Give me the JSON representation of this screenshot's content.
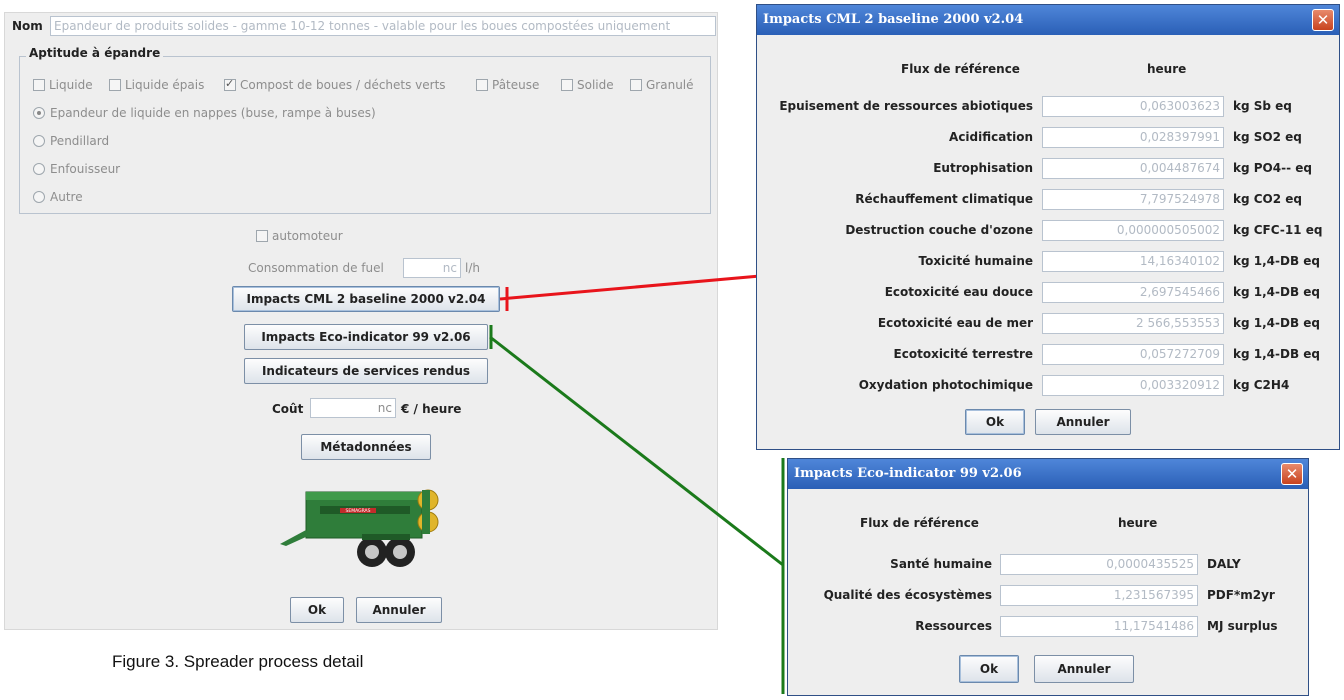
{
  "main": {
    "name_label": "Nom",
    "name_value": "Epandeur de produits solides - gamme 10-12 tonnes - valable pour les boues compostées uniquement",
    "aptitude_title": "Aptitude à épandre",
    "checkboxes": [
      {
        "label": "Liquide",
        "checked": false
      },
      {
        "label": "Liquide épais",
        "checked": false
      },
      {
        "label": "Compost de boues / déchets verts",
        "checked": true
      },
      {
        "label": "Pâteuse",
        "checked": false
      },
      {
        "label": "Solide",
        "checked": false
      },
      {
        "label": "Granulé",
        "checked": false
      }
    ],
    "radios": [
      {
        "label": "Epandeur de liquide en nappes (buse, rampe à buses)",
        "selected": true
      },
      {
        "label": "Pendillard",
        "selected": false
      },
      {
        "label": "Enfouisseur",
        "selected": false
      },
      {
        "label": "Autre",
        "selected": false
      }
    ],
    "automoteur_label": "automoteur",
    "fuel_label": "Consommation de fuel",
    "fuel_value": "nc",
    "fuel_unit": "l/h",
    "btn_cml": "Impacts CML 2 baseline 2000 v2.04",
    "btn_eco": "Impacts Eco-indicator 99 v2.06",
    "btn_services": "Indicateurs de services rendus",
    "cost_label": "Coût",
    "cost_value": "nc",
    "cost_unit": "€ / heure",
    "btn_meta": "Métadonnées",
    "tractor_brand": "SEMAGRAS",
    "btn_ok": "Ok",
    "btn_cancel": "Annuler"
  },
  "cml_dialog": {
    "title": "Impacts CML 2 baseline 2000 v2.04",
    "header_label": "Flux de référence",
    "header_unit": "heure",
    "rows": [
      {
        "label": "Epuisement de ressources abiotiques",
        "value": "0,063003623",
        "unit": "kg Sb eq"
      },
      {
        "label": "Acidification",
        "value": "0,028397991",
        "unit": "kg SO2 eq"
      },
      {
        "label": "Eutrophisation",
        "value": "0,004487674",
        "unit": "kg PO4-- eq"
      },
      {
        "label": "Réchauffement climatique",
        "value": "7,797524978",
        "unit": "kg CO2 eq"
      },
      {
        "label": "Destruction couche d'ozone",
        "value": "0,000000505002",
        "unit": "kg CFC-11 eq"
      },
      {
        "label": "Toxicité humaine",
        "value": "14,16340102",
        "unit": "kg 1,4-DB eq"
      },
      {
        "label": "Ecotoxicité eau douce",
        "value": "2,697545466",
        "unit": "kg 1,4-DB eq"
      },
      {
        "label": "Ecotoxicité eau de mer",
        "value": "2 566,553553",
        "unit": "kg 1,4-DB eq"
      },
      {
        "label": "Ecotoxicité terrestre",
        "value": "0,057272709",
        "unit": "kg 1,4-DB eq"
      },
      {
        "label": "Oxydation photochimique",
        "value": "0,003320912",
        "unit": "kg C2H4"
      }
    ],
    "btn_ok": "Ok",
    "btn_cancel": "Annuler",
    "close_glyph": "✕"
  },
  "eco_dialog": {
    "title": "Impacts Eco-indicator 99 v2.06",
    "header_label": "Flux de référence",
    "header_unit": "heure",
    "rows": [
      {
        "label": "Santé humaine",
        "value": "0,0000435525",
        "unit": "DALY"
      },
      {
        "label": "Qualité des écosystèmes",
        "value": "1,231567395",
        "unit": "PDF*m2yr"
      },
      {
        "label": "Ressources",
        "value": "11,17541486",
        "unit": "MJ surplus"
      }
    ],
    "btn_ok": "Ok",
    "btn_cancel": "Annuler",
    "close_glyph": "✕"
  },
  "caption": "Figure 3. Spreader process detail",
  "colors": {
    "titlebar": "#2a5fb6",
    "connector_cml": "#e8141b",
    "connector_eco": "#1b7a1b",
    "field_text": "#b2bac4"
  }
}
